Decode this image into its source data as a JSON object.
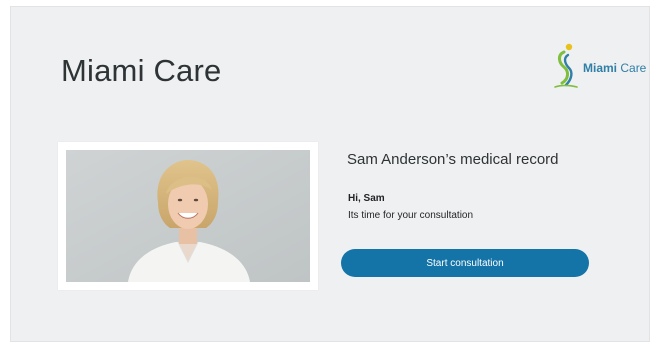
{
  "header": {
    "app_title": "Miami Care",
    "brand_name_bold": "Miami",
    "brand_name_regular": " Care"
  },
  "patient_card": {
    "record_title": "Sam Anderson’s medical record",
    "greeting": "Hi, Sam",
    "message": "Its time for your consultation",
    "start_button_label": "Start consultation"
  },
  "colors": {
    "accent": "#1574a7",
    "background": "#eff0f1",
    "text": "#2e3336",
    "logo_yellow": "#e8c21c",
    "logo_green": "#7fbe3f",
    "logo_blue": "#2f7fa8"
  },
  "icons": {
    "brand_logo": "miami-care-logo-icon",
    "portrait": "doctor-portrait"
  }
}
